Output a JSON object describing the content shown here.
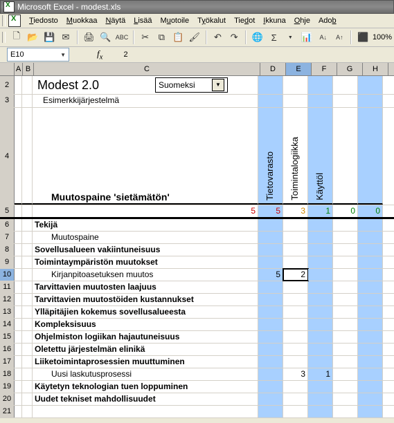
{
  "window": {
    "title": "Microsoft Excel - modest.xls"
  },
  "menu": {
    "items": [
      "Tiedosto",
      "Muokkaa",
      "Näytä",
      "Lisää",
      "Muotoile",
      "Työkalut",
      "Tiedot",
      "Ikkuna",
      "Ohje",
      "Adob"
    ]
  },
  "toolbar": {
    "zoom": "100%"
  },
  "namebox": {
    "ref": "E10",
    "fx_value": "2"
  },
  "columns": [
    "A",
    "B",
    "C",
    "D",
    "E",
    "F",
    "G",
    "H"
  ],
  "sheet": {
    "title": "Modest 2.0",
    "lang_combo": "Suomeksi",
    "subtitle": "Esimerkkijärjestelmä",
    "section_label": "Muutospaine 'sietämätön'",
    "col_labels": {
      "D": "Tietovarasto",
      "E": "Toimintalogiikka",
      "F": "Käyttöl"
    },
    "row5": {
      "C": "5",
      "D": "5",
      "E": "3",
      "F": "1",
      "G": "0",
      "H": "0"
    },
    "rows": [
      {
        "n": 6,
        "bold": true,
        "text": "Tekijä"
      },
      {
        "n": 7,
        "bold": false,
        "text": "Muutospaine"
      },
      {
        "n": 8,
        "bold": true,
        "text": "Sovellusalueen vakiintuneisuus"
      },
      {
        "n": 9,
        "bold": true,
        "text": "Toimintaympäristön muutokset"
      },
      {
        "n": 10,
        "bold": false,
        "text": "Kirjanpitoasetuksen muutos",
        "D": "5",
        "E": "2"
      },
      {
        "n": 11,
        "bold": true,
        "text": "Tarvittavien muutosten laajuus"
      },
      {
        "n": 12,
        "bold": true,
        "text": "Tarvittavien muutostöiden kustannukset"
      },
      {
        "n": 13,
        "bold": true,
        "text": "Ylläpitäjien kokemus sovellusalueesta"
      },
      {
        "n": 14,
        "bold": true,
        "text": "Kompleksisuus"
      },
      {
        "n": 15,
        "bold": true,
        "text": "Ohjelmiston logiikan hajautuneisuus"
      },
      {
        "n": 16,
        "bold": true,
        "text": "Oletettu järjestelmän elinikä"
      },
      {
        "n": 17,
        "bold": true,
        "text": "Liiketoimintaprosessien muuttuminen"
      },
      {
        "n": 18,
        "bold": false,
        "text": "Uusi laskutusprosessi",
        "E": "3",
        "F": "1"
      },
      {
        "n": 19,
        "bold": true,
        "text": "Käytetyn teknologian tuen loppuminen"
      },
      {
        "n": 20,
        "bold": true,
        "text": "Uudet tekniset mahdollisuudet"
      }
    ]
  },
  "chart_data": null
}
